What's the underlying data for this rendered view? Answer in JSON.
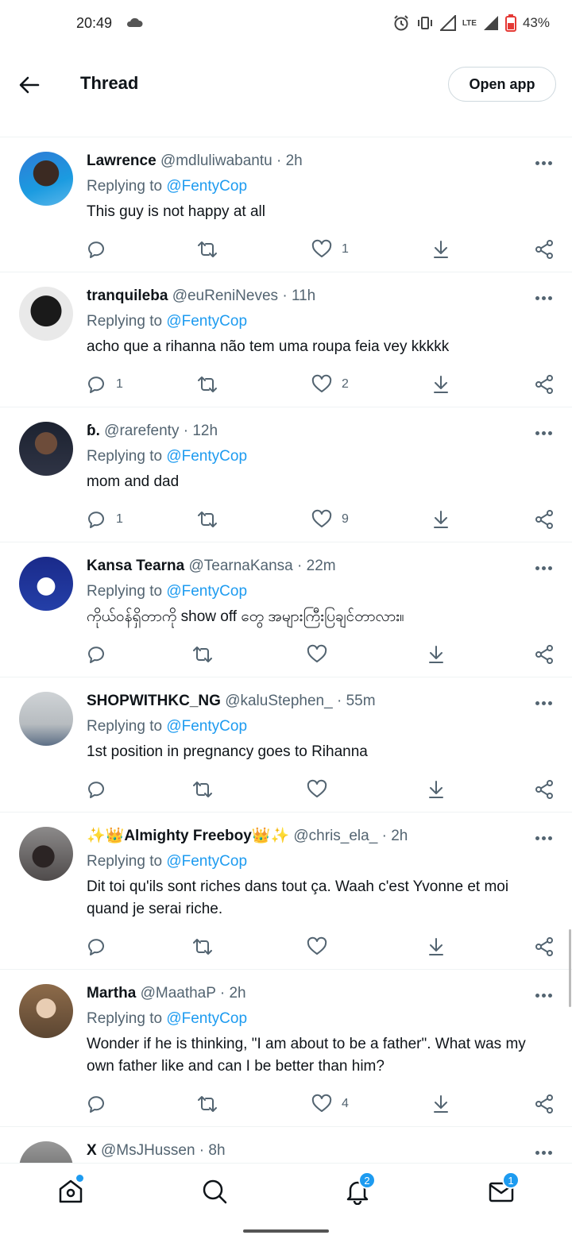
{
  "status_bar": {
    "time": "20:49",
    "battery": "43%",
    "network": "LTE"
  },
  "header": {
    "title": "Thread",
    "open_app": "Open app"
  },
  "tweets": [
    {
      "name": "Lawrence",
      "handle": "@mdluliwabantu",
      "time": "2h",
      "replying_label": "Replying to",
      "replying_to": "@FentyCop",
      "text": "This guy is not happy at all",
      "replies": "",
      "likes": "1"
    },
    {
      "name": "tranquileba",
      "handle": "@euReniNeves",
      "time": "11h",
      "replying_label": "Replying to",
      "replying_to": "@FentyCop",
      "text": "acho que a rihanna não tem uma roupa feia vey kkkkk",
      "replies": "1",
      "likes": "2"
    },
    {
      "name": "ɓ.",
      "handle": "@rarefenty",
      "time": "12h",
      "replying_label": "Replying to",
      "replying_to": "@FentyCop",
      "text": "mom and dad",
      "replies": "1",
      "likes": "9"
    },
    {
      "name": "Kansa Tearna",
      "handle": "@TearnaKansa",
      "time": "22m",
      "replying_label": "Replying to",
      "replying_to": "@FentyCop",
      "text": "ကိုယ်ဝန်ရှိတာကို show off တွေ အများကြီးပြချင်တာလား။",
      "replies": "",
      "likes": ""
    },
    {
      "name": "SHOPWITHKC_NG",
      "handle": "@kaluStephen_",
      "time": "55m",
      "replying_label": "Replying to",
      "replying_to": "@FentyCop",
      "text": "1st position in pregnancy goes to Rihanna",
      "replies": "",
      "likes": ""
    },
    {
      "name": "✨👑Almighty Freeboy👑✨",
      "handle": "@chris_ela_",
      "time": "2h",
      "replying_label": "Replying to",
      "replying_to": "@FentyCop",
      "text": "Dit toi qu'ils sont riches dans tout ça. Waah c'est Yvonne et moi quand je serai riche.",
      "replies": "",
      "likes": ""
    },
    {
      "name": "Martha",
      "handle": "@MaathaP",
      "time": "2h",
      "replying_label": "Replying to",
      "replying_to": "@FentyCop",
      "text": "Wonder if he is thinking, \"I am about to be a father\". What was my own father like and can I be better than him?",
      "replies": "",
      "likes": "4"
    },
    {
      "name": "X",
      "handle": "@MsJHussen",
      "time": "8h",
      "replying_label": "",
      "replying_to": "",
      "text": "",
      "replies": "",
      "likes": ""
    }
  ],
  "bottom_nav": {
    "notifications_count": "2",
    "messages_count": "1"
  },
  "colors": {
    "accent": "#1d9bf0",
    "text": "#0f1419",
    "secondary": "#536471",
    "divider": "#eff3f4"
  }
}
